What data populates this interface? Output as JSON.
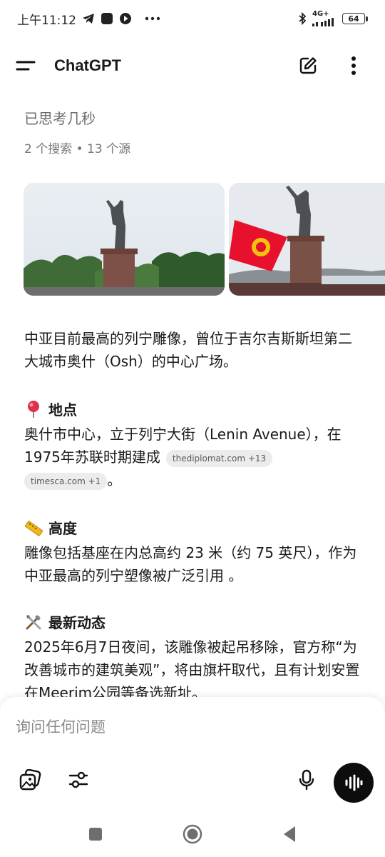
{
  "status_bar": {
    "time": "上午11:12",
    "icons": [
      "telegram-icon",
      "app-square-icon",
      "play-circle-icon",
      "more-dots-icon"
    ],
    "right_icons": [
      "bluetooth-icon",
      "signal-icon"
    ],
    "network_label": "4G+",
    "battery": "64"
  },
  "header": {
    "title": "ChatGPT",
    "icons": {
      "menu": "menu-icon",
      "new_chat": "edit-icon",
      "more": "more-vertical-icon"
    }
  },
  "content": {
    "thinking_label": "已思考几秒",
    "sources_label": "2 个搜索 • 13 个源",
    "images": [
      {
        "name": "lenin-statue-photo-1"
      },
      {
        "name": "lenin-statue-photo-2"
      }
    ],
    "intro": "中亚目前最高的列宁雕像，曾位于吉尔吉斯斯坦第二大城市奥什（Osh）的中心广场。",
    "sections": {
      "location": {
        "icon": "pin-icon",
        "title": "地点",
        "text": "奥什市中心，立于列宁大街（Lenin Avenue），在1975年苏联时期建成",
        "chip1": "thediplomat.com +13",
        "chip2": "timesca.com +1",
        "end": "。"
      },
      "height": {
        "icon": "ruler-icon",
        "title": "高度",
        "text": "雕像包括基座在内总高约 23 米（约 75 英尺），作为中亚最高的列宁塑像被广泛引用 。"
      },
      "latest": {
        "icon": "tools-icon",
        "title": "最新动态",
        "text": "2025年6月7日夜间，该雕像被起吊移除，官方称“为改善城市的建筑美观”，将由旗杆取代，且有计划安置在Meerim公园等备选新址。"
      }
    }
  },
  "composer": {
    "placeholder": "询问任何问题",
    "icons": [
      "image-upload-icon",
      "tools-sliders-icon",
      "microphone-icon",
      "voice-mode-icon"
    ]
  },
  "nav": {
    "icons": [
      "recents-icon",
      "home-icon",
      "back-icon"
    ]
  },
  "colors": {
    "text": "#1a1a1a",
    "muted": "#6b6b6b",
    "chip_bg": "#ececec",
    "flag_red": "#e8112d",
    "accent_dark": "#0d0d0d"
  }
}
